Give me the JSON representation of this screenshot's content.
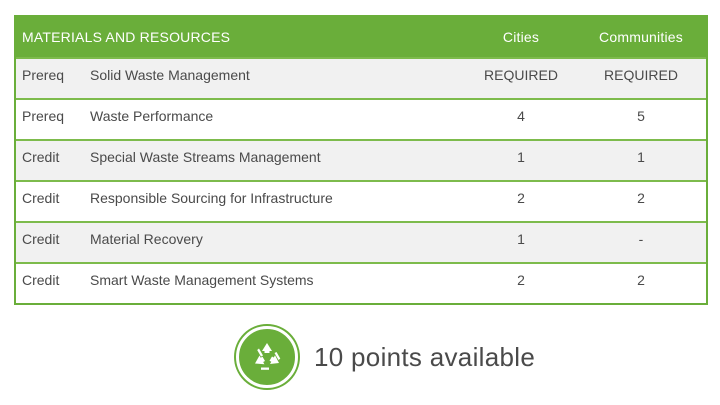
{
  "table": {
    "header": {
      "title": "MATERIALS AND RESOURCES",
      "col_cities": "Cities",
      "col_communities": "Communities"
    },
    "rows": [
      {
        "type": "Prereq",
        "name": "Solid Waste Management",
        "cities": "REQUIRED",
        "communities": "REQUIRED"
      },
      {
        "type": "Prereq",
        "name": "Waste Performance",
        "cities": "4",
        "communities": "5"
      },
      {
        "type": "Credit",
        "name": "Special Waste Streams Management",
        "cities": "1",
        "communities": "1"
      },
      {
        "type": "Credit",
        "name": "Responsible Sourcing for Infrastructure",
        "cities": "2",
        "communities": "2"
      },
      {
        "type": "Credit",
        "name": "Material Recovery",
        "cities": "1",
        "communities": "-"
      },
      {
        "type": "Credit",
        "name": "Smart Waste Management Systems",
        "cities": "2",
        "communities": "2"
      }
    ]
  },
  "footer": {
    "icon": "recycle-icon",
    "text": "10 points available"
  },
  "colors": {
    "accent": "#6aae3a",
    "row_shade": "#f1f1f1",
    "text": "#4a4a4a"
  }
}
